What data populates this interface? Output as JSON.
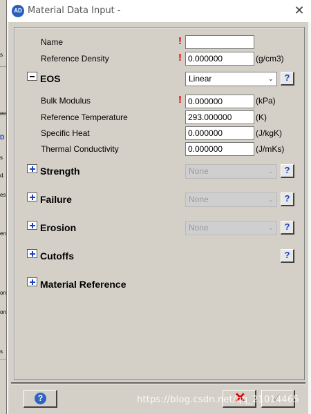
{
  "window": {
    "title": "Material Data Input -",
    "app_icon_text": "AD"
  },
  "background_app": {
    "fragments": [
      "s",
      "ee",
      "D",
      "s",
      "d.",
      "es",
      "en",
      "on",
      "on",
      "s"
    ]
  },
  "fields": {
    "name": {
      "label": "Name",
      "value": "",
      "required": true
    },
    "reference_density": {
      "label": "Reference Density",
      "value": "0.000000",
      "unit": "(g/cm3)",
      "required": true
    }
  },
  "eos": {
    "label": "EOS",
    "expanded": true,
    "selected": "Linear",
    "fields": {
      "bulk_modulus": {
        "label": "Bulk Modulus",
        "value": "0.000000",
        "unit": "(kPa)",
        "required": true
      },
      "reference_temperature": {
        "label": "Reference Temperature",
        "value": "293.000000",
        "unit": "(K)"
      },
      "specific_heat": {
        "label": "Specific Heat",
        "value": "0.000000",
        "unit": "(J/kgK)"
      },
      "thermal_conductivity": {
        "label": "Thermal Conductivity",
        "value": "0.000000",
        "unit": "(J/mKs)"
      }
    }
  },
  "sections": {
    "strength": {
      "label": "Strength",
      "selected": "None",
      "enabled": false
    },
    "failure": {
      "label": "Failure",
      "selected": "None",
      "enabled": false
    },
    "erosion": {
      "label": "Erosion",
      "selected": "None",
      "enabled": false
    },
    "cutoffs": {
      "label": "Cutoffs"
    },
    "material_reference": {
      "label": "Material Reference"
    }
  },
  "help_glyph": "?",
  "required_glyph": "!",
  "chevron_glyph": "⌄",
  "toolbar": {
    "help_glyph": "?",
    "cancel_glyph": "✕",
    "ok_glyph": "✓"
  },
  "watermark": "https://blog.csdn.net/qq_21014465",
  "colors": {
    "required": "#e00000",
    "help_blue": "#1a3fc2",
    "dialog_bg": "#d4d0c8"
  }
}
